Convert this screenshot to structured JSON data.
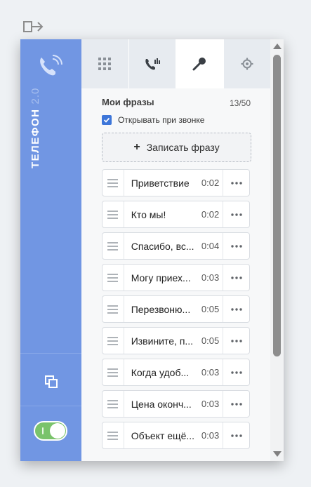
{
  "app": {
    "title": "ТЕЛЕФОН",
    "version": "2.0",
    "toggle_on": true
  },
  "tabs": [
    {
      "icon": "grid-icon",
      "active": false
    },
    {
      "icon": "phone-call-icon",
      "active": false
    },
    {
      "icon": "microphone-icon",
      "active": true
    },
    {
      "icon": "gear-icon",
      "active": false
    }
  ],
  "phrases": {
    "header": "Мои фразы",
    "count": "13/50",
    "open_on_call": "Открывать при звонке",
    "open_on_call_checked": true,
    "record_button": "Записать фразу",
    "items": [
      {
        "name": "Приветствие",
        "duration": "0:02"
      },
      {
        "name": "Кто мы!",
        "duration": "0:02"
      },
      {
        "name": "Спасибо, вс...",
        "duration": "0:04"
      },
      {
        "name": "Могу приех...",
        "duration": "0:03"
      },
      {
        "name": "Перезвоню...",
        "duration": "0:05"
      },
      {
        "name": "Извините, п...",
        "duration": "0:05"
      },
      {
        "name": "Когда удоб...",
        "duration": "0:03"
      },
      {
        "name": "Цена оконч...",
        "duration": "0:03"
      },
      {
        "name": "Объект ещё...",
        "duration": "0:03"
      }
    ]
  },
  "colors": {
    "sidebar": "#7196e3",
    "accent": "#3d76d9",
    "toggle": "#7ac36b"
  }
}
